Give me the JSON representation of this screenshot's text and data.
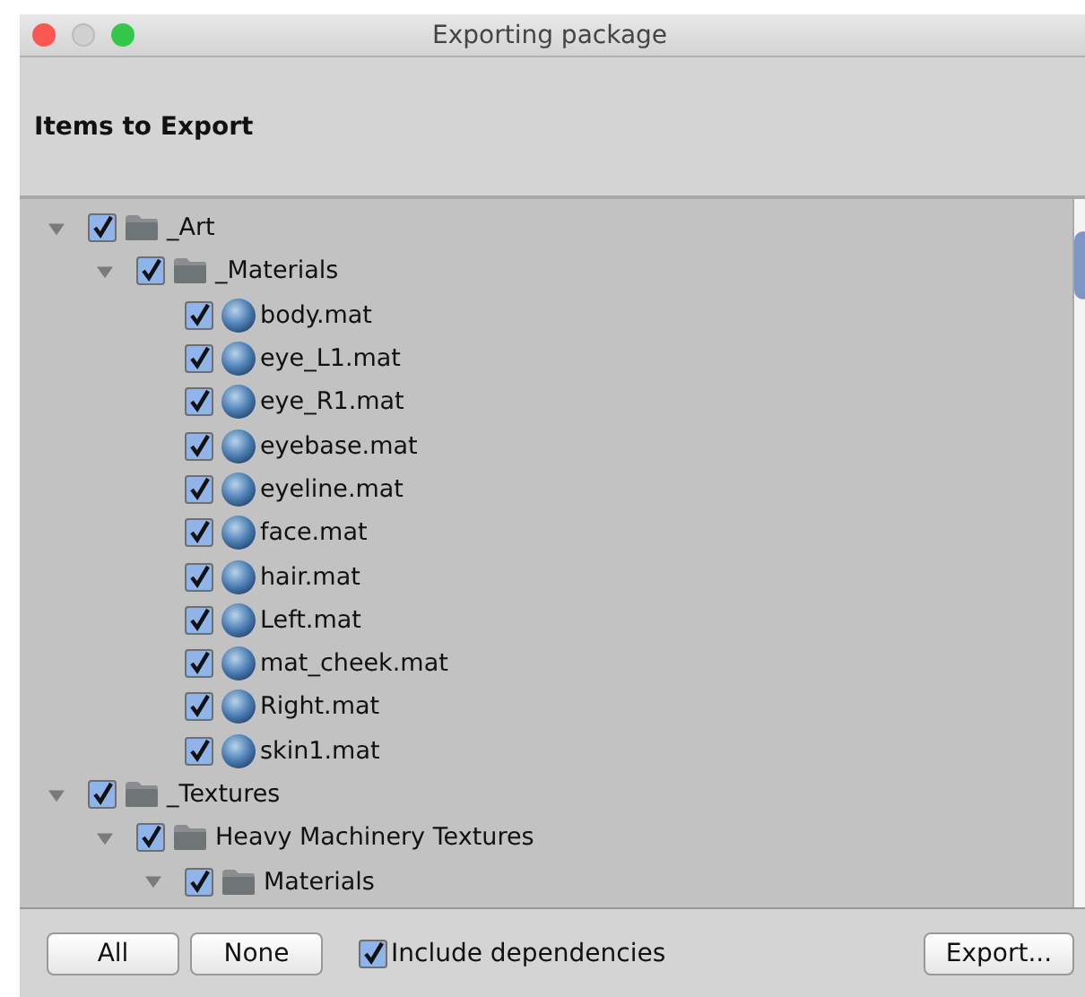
{
  "window": {
    "title": "Exporting package"
  },
  "header": {
    "title": "Items to Export"
  },
  "tree": [
    {
      "kind": "folder",
      "label": "_Art",
      "checked": true,
      "expanded": true,
      "children": [
        {
          "kind": "folder",
          "label": "_Materials",
          "checked": true,
          "expanded": true,
          "children": [
            {
              "kind": "material",
              "label": "body.mat",
              "checked": true
            },
            {
              "kind": "material",
              "label": "eye_L1.mat",
              "checked": true
            },
            {
              "kind": "material",
              "label": "eye_R1.mat",
              "checked": true
            },
            {
              "kind": "material",
              "label": "eyebase.mat",
              "checked": true
            },
            {
              "kind": "material",
              "label": "eyeline.mat",
              "checked": true
            },
            {
              "kind": "material",
              "label": "face.mat",
              "checked": true
            },
            {
              "kind": "material",
              "label": "hair.mat",
              "checked": true
            },
            {
              "kind": "material",
              "label": "Left.mat",
              "checked": true
            },
            {
              "kind": "material",
              "label": "mat_cheek.mat",
              "checked": true
            },
            {
              "kind": "material",
              "label": "Right.mat",
              "checked": true
            },
            {
              "kind": "material",
              "label": "skin1.mat",
              "checked": true
            }
          ]
        }
      ]
    },
    {
      "kind": "folder",
      "label": "_Textures",
      "checked": true,
      "expanded": true,
      "children": [
        {
          "kind": "folder",
          "label": "Heavy Machinery Textures",
          "checked": true,
          "expanded": true,
          "children": [
            {
              "kind": "folder",
              "label": "Materials",
              "checked": true,
              "expanded": true
            }
          ]
        }
      ]
    }
  ],
  "footer": {
    "buttons": [
      {
        "label": "All"
      },
      {
        "label": "None"
      }
    ],
    "include_dependencies": {
      "label": "Include dependencies",
      "checked": true
    },
    "export": {
      "label": "Export..."
    }
  }
}
